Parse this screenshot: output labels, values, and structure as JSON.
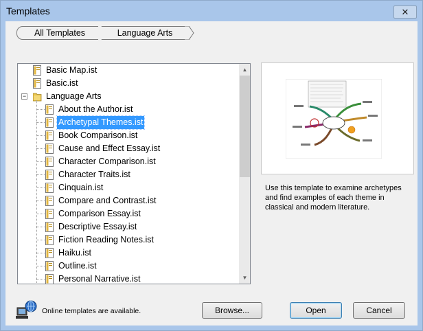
{
  "window": {
    "title": "Templates",
    "close_glyph": "✕"
  },
  "breadcrumb": {
    "items": [
      "All Templates",
      "Language Arts"
    ]
  },
  "tree": {
    "rows": [
      {
        "label": "Basic Map.ist",
        "kind": "file",
        "level": 0
      },
      {
        "label": "Basic.ist",
        "kind": "file",
        "level": 0
      },
      {
        "label": "Language Arts",
        "kind": "folder",
        "level": 0,
        "expander": "−"
      },
      {
        "label": "About the Author.ist",
        "kind": "file",
        "level": 1
      },
      {
        "label": "Archetypal Themes.ist",
        "kind": "file",
        "level": 1,
        "selected": true
      },
      {
        "label": "Book Comparison.ist",
        "kind": "file",
        "level": 1
      },
      {
        "label": "Cause and Effect Essay.ist",
        "kind": "file",
        "level": 1
      },
      {
        "label": "Character Comparison.ist",
        "kind": "file",
        "level": 1
      },
      {
        "label": "Character Traits.ist",
        "kind": "file",
        "level": 1
      },
      {
        "label": "Cinquain.ist",
        "kind": "file",
        "level": 1
      },
      {
        "label": "Compare and Contrast.ist",
        "kind": "file",
        "level": 1
      },
      {
        "label": "Comparison Essay.ist",
        "kind": "file",
        "level": 1
      },
      {
        "label": "Descriptive Essay.ist",
        "kind": "file",
        "level": 1
      },
      {
        "label": "Fiction Reading Notes.ist",
        "kind": "file",
        "level": 1
      },
      {
        "label": "Haiku.ist",
        "kind": "file",
        "level": 1
      },
      {
        "label": "Outline.ist",
        "kind": "file",
        "level": 1
      },
      {
        "label": "Personal Narrative.ist",
        "kind": "file",
        "level": 1
      }
    ]
  },
  "scrollbar": {
    "up_glyph": "▲",
    "down_glyph": "▼",
    "position": 0.0
  },
  "preview": {
    "description": "Use this template to examine archetypes and find examples of each theme in classical and modern literature."
  },
  "footer": {
    "online_text": "Online templates are available.",
    "browse_label": "Browse...",
    "open_label": "Open",
    "cancel_label": "Cancel"
  },
  "colors": {
    "selection": "#3399ff",
    "title_bar": "#a9c6ea"
  }
}
